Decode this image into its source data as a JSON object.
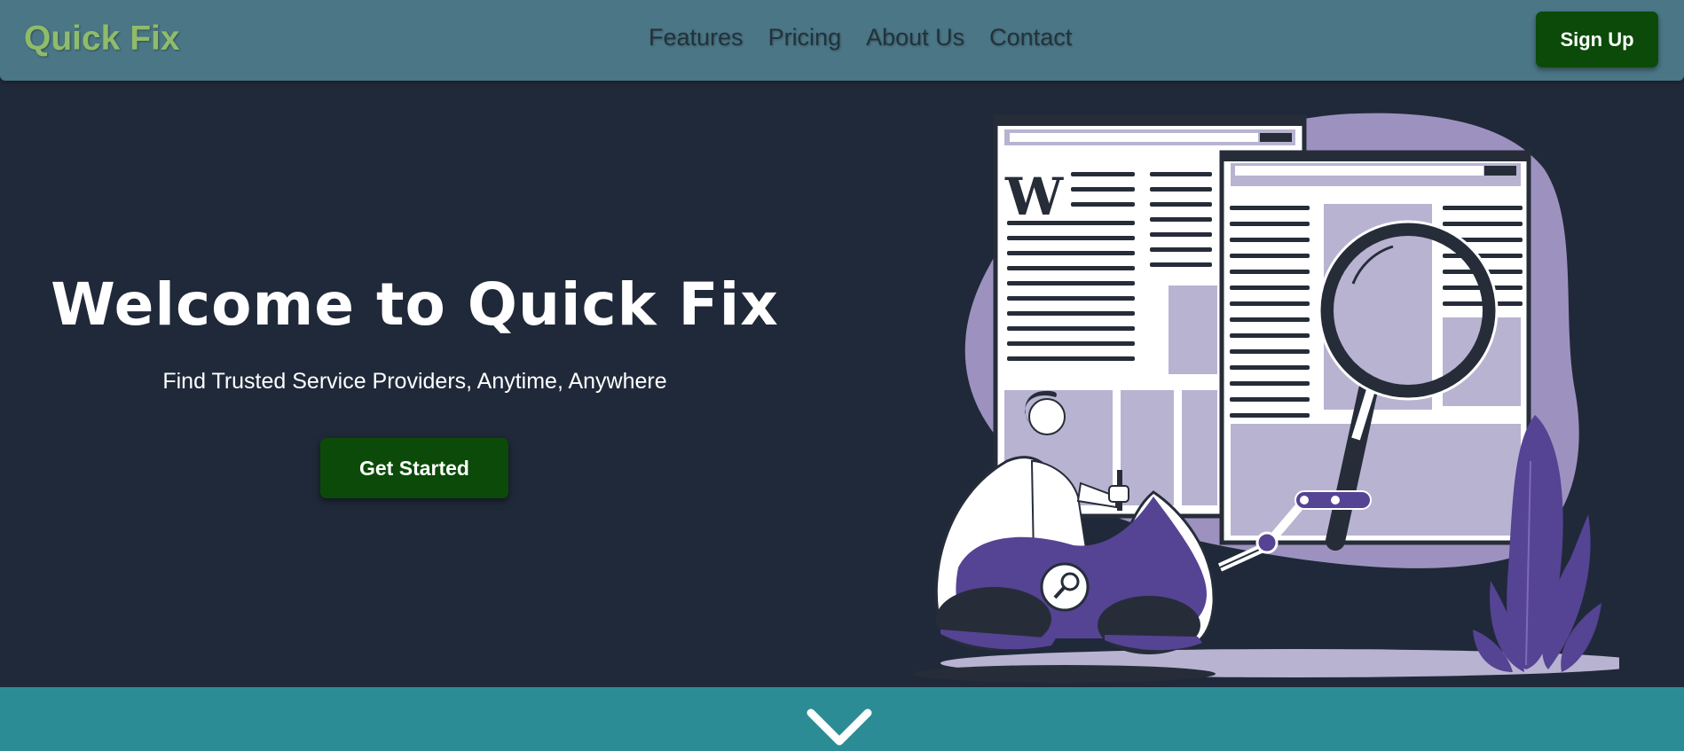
{
  "nav": {
    "brand": "Quick Fix",
    "links": [
      "Features",
      "Pricing",
      "About Us",
      "Contact"
    ],
    "signup_label": "Sign Up"
  },
  "hero": {
    "title": "Welcome to Quick Fix",
    "subtitle": "Find Trusted Service Providers, Anytime, Anywhere",
    "cta_label": "Get Started"
  },
  "illustration": {
    "page_letter": "W"
  },
  "colors": {
    "navbar": "#4a7686",
    "brand": "#8fbc6a",
    "background": "#202939",
    "button": "#0b4a09",
    "footer": "#2c8c96",
    "accent_purple": "#554393",
    "light_purple": "#9d92bf"
  },
  "icons": {
    "scroll": "chevron-down-icon"
  }
}
